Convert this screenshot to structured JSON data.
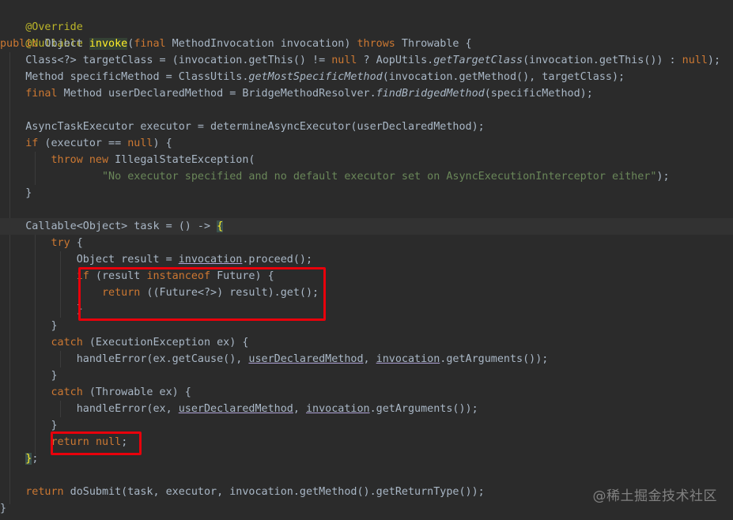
{
  "code": {
    "l0": "@Override",
    "l1": "@Nullable",
    "l2": {
      "kw_public": "public",
      "t_object": " Object ",
      "method_invoke": "invoke",
      "p_open": "(",
      "kw_final": "final",
      "t_params": " MethodInvocation invocation) ",
      "kw_throws": "throws",
      "t_throwable": " Throwable {"
    },
    "l3": {
      "a": "    Class<?> targetClass = (invocation.getThis() != ",
      "null1": "null",
      "b": " ? AopUtils.",
      "m": "getTargetClass",
      "c": "(invocation.getThis()) : ",
      "null2": "null",
      "d": ");"
    },
    "l4": {
      "a": "    Method specificMethod = ClassUtils.",
      "m": "getMostSpecificMethod",
      "b": "(invocation.getMethod(), targetClass);"
    },
    "l5": {
      "ind": "    ",
      "kw_final": "final",
      "a": " Method userDeclaredMethod = BridgeMethodResolver.",
      "m": "findBridgedMethod",
      "b": "(specificMethod);"
    },
    "l7": "    AsyncTaskExecutor executor = determineAsyncExecutor(userDeclaredMethod);",
    "l8": {
      "ind": "    ",
      "kw_if": "if",
      "a": " (executor == ",
      "kw_null": "null",
      "b": ") {"
    },
    "l9": {
      "ind": "        ",
      "kw_throw": "throw",
      "sp": " ",
      "kw_new": "new",
      "a": " IllegalStateException("
    },
    "l10": {
      "ind": "                ",
      "str": "\"No executor specified and no default executor set on AsyncExecutionInterceptor either\"",
      "a": ");"
    },
    "l11": "    }",
    "l13": {
      "a": "    Callable<Object> task = () -> ",
      "brace": "{"
    },
    "l14": {
      "ind": "        ",
      "kw_try": "try",
      "a": " {"
    },
    "l15": {
      "a": "            Object result = ",
      "cap": "invocation",
      "b": ".proceed();"
    },
    "l16": {
      "ind": "            ",
      "kw_if": "if",
      "a": " (result ",
      "kw_instanceof": "instanceof",
      "b": " Future) {"
    },
    "l17": {
      "ind": "                ",
      "kw_return": "return",
      "a": " ((Future<?>) result).get();"
    },
    "l18": "            }",
    "l19": "        }",
    "l20": {
      "ind": "        ",
      "kw_catch": "catch",
      "a": " (ExecutionException ex) {"
    },
    "l21": {
      "a": "            handleError(ex.getCause(), ",
      "cap1": "userDeclaredMethod",
      "b": ", ",
      "cap2": "invocation",
      "c": ".getArguments());"
    },
    "l22": "        }",
    "l23": {
      "ind": "        ",
      "kw_catch": "catch",
      "a": " (Throwable ex) {"
    },
    "l24": {
      "a": "            handleError(ex, ",
      "cap1": "userDeclaredMethod",
      "b": ", ",
      "cap2": "invocation",
      "c": ".getArguments());"
    },
    "l25": "        }",
    "l26": {
      "ind": "        ",
      "kw_return": "return",
      "sp": " ",
      "kw_null": "null",
      "a": ";"
    },
    "l27": {
      "ind": "    ",
      "brace": "}",
      "a": ";"
    },
    "l29": {
      "ind": "    ",
      "kw_return": "return",
      "a": " doSubmit(task, executor, invocation.getMethod().getReturnType());"
    },
    "l30": "}"
  },
  "watermark": "@稀土掘金技术社区",
  "colors": {
    "background": "#2b2b2b",
    "keyword": "#cc7832",
    "annotation": "#bbb529",
    "string": "#6a8759",
    "text": "#a9b7c6",
    "highlight_box": "#e8000b"
  }
}
